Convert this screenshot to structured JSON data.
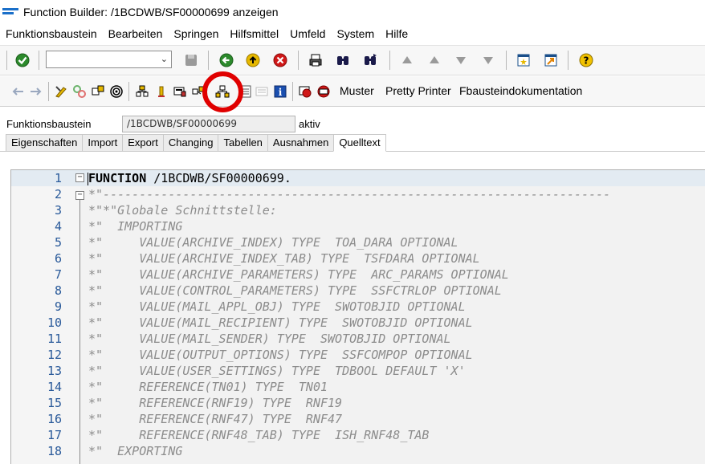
{
  "window": {
    "title": "Function Builder: /1BCDWB/SF00000699 anzeigen",
    "logo_icon": "sap-logo-icon"
  },
  "menu": [
    "Funktionsbaustein",
    "Bearbeiten",
    "Springen",
    "Hilfsmittel",
    "Umfeld",
    "System",
    "Hilfe"
  ],
  "toolbar1": {
    "command_field_value": "",
    "icons": [
      "enter-check-icon",
      "save-icon",
      "back-icon",
      "exit-icon",
      "cancel-icon",
      "print-icon",
      "find-icon",
      "find-next-icon",
      "first-page-icon",
      "previous-page-icon",
      "next-page-icon",
      "last-page-icon",
      "create-session-icon",
      "shortcut-icon",
      "help-icon"
    ]
  },
  "toolbar2": {
    "icons": [
      "back-arrow-icon",
      "forward-arrow-icon",
      "change-display-icon",
      "active-inactive-icon",
      "check-object-icon",
      "activate-icon",
      "test-icon",
      "where-used-icon",
      "enhance-icon",
      "object-list-icon",
      "hierarchy-icon",
      "navigation-window-icon",
      "display-object-icon",
      "info-icon",
      "breakpoint-icon",
      "external-breakpoint-icon"
    ],
    "muster_label": "Muster",
    "pretty_printer_label": "Pretty Printer",
    "doc_label": "Fbausteindokumentation"
  },
  "function_module": {
    "label": "Funktionsbaustein",
    "value": "/1BCDWB/SF00000699",
    "status": "aktiv"
  },
  "tabs": [
    {
      "label": "Eigenschaften",
      "active": false
    },
    {
      "label": "Import",
      "active": false
    },
    {
      "label": "Export",
      "active": false
    },
    {
      "label": "Changing",
      "active": false
    },
    {
      "label": "Tabellen",
      "active": false
    },
    {
      "label": "Ausnahmen",
      "active": false
    },
    {
      "label": "Quelltext",
      "active": true
    }
  ],
  "source": [
    {
      "n": "1",
      "keyword": "FUNCTION",
      "text": " /1BCDWB/SF00000699.",
      "fold": "minus"
    },
    {
      "n": "2",
      "text": "*\"----------------------------------------------------------------------",
      "fold": "minus"
    },
    {
      "n": "3",
      "text": "*\"*\"Globale Schnittstelle:"
    },
    {
      "n": "4",
      "text": "*\"  IMPORTING"
    },
    {
      "n": "5",
      "text": "*\"     VALUE(ARCHIVE_INDEX) TYPE  TOA_DARA OPTIONAL"
    },
    {
      "n": "6",
      "text": "*\"     VALUE(ARCHIVE_INDEX_TAB) TYPE  TSFDARA OPTIONAL"
    },
    {
      "n": "7",
      "text": "*\"     VALUE(ARCHIVE_PARAMETERS) TYPE  ARC_PARAMS OPTIONAL"
    },
    {
      "n": "8",
      "text": "*\"     VALUE(CONTROL_PARAMETERS) TYPE  SSFCTRLOP OPTIONAL"
    },
    {
      "n": "9",
      "text": "*\"     VALUE(MAIL_APPL_OBJ) TYPE  SWOTOBJID OPTIONAL"
    },
    {
      "n": "10",
      "text": "*\"     VALUE(MAIL_RECIPIENT) TYPE  SWOTOBJID OPTIONAL"
    },
    {
      "n": "11",
      "text": "*\"     VALUE(MAIL_SENDER) TYPE  SWOTOBJID OPTIONAL"
    },
    {
      "n": "12",
      "text": "*\"     VALUE(OUTPUT_OPTIONS) TYPE  SSFCOMPOP OPTIONAL"
    },
    {
      "n": "13",
      "text": "*\"     VALUE(USER_SETTINGS) TYPE  TDBOOL DEFAULT 'X'"
    },
    {
      "n": "14",
      "text": "*\"     REFERENCE(TN01) TYPE  TN01"
    },
    {
      "n": "15",
      "text": "*\"     REFERENCE(RNF19) TYPE  RNF19"
    },
    {
      "n": "16",
      "text": "*\"     REFERENCE(RNF47) TYPE  RNF47"
    },
    {
      "n": "17",
      "text": "*\"     REFERENCE(RNF48_TAB) TYPE  ISH_RNF48_TAB"
    },
    {
      "n": "18",
      "text": "*\"  EXPORTING"
    }
  ],
  "colors": {
    "highlight_circle": "#e00000",
    "current_line": "#e3ebf2",
    "line_numbers": "#2a5a9a",
    "comment_text": "#8c8c8c"
  }
}
